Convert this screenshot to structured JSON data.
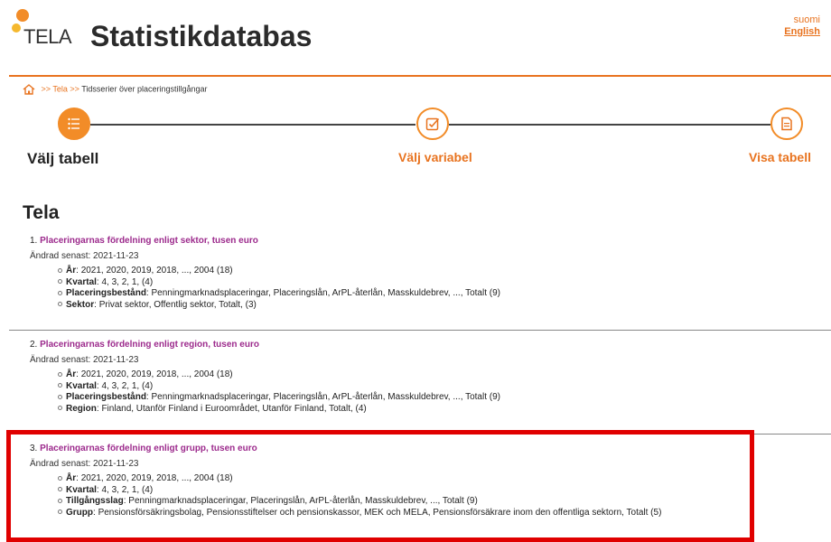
{
  "header": {
    "logo_text": "TELA",
    "title": "Statistikdatabas",
    "languages": [
      {
        "label": "suomi",
        "active": false
      },
      {
        "label": "English",
        "active": true
      }
    ]
  },
  "breadcrumb": {
    "home_icon": "home-icon",
    "separator": ">>",
    "items": [
      "Tela",
      "Tidsserier över placeringstillgångar"
    ]
  },
  "steps": [
    {
      "label": "Välj tabell",
      "icon": "list-icon",
      "active": true
    },
    {
      "label": "Välj variabel",
      "icon": "checkbox-icon",
      "active": false
    },
    {
      "label": "Visa tabell",
      "icon": "document-icon",
      "active": false
    }
  ],
  "section_title": "Tela",
  "updated_label": "Ändrad senast:",
  "tables": [
    {
      "number": "1.",
      "title": "Placeringarnas fördelning enligt sektor, tusen euro",
      "updated": "2021-11-23",
      "variables": [
        {
          "name": "År",
          "values": "2021, 2020, 2019, 2018, ..., 2004 (18)"
        },
        {
          "name": "Kvartal",
          "values": "4, 3, 2, 1, (4)"
        },
        {
          "name": "Placeringsbestånd",
          "values": "Penningmarknadsplaceringar, Placeringslån, ArPL-återlån, Masskuldebrev, ..., Totalt (9)"
        },
        {
          "name": "Sektor",
          "values": "Privat sektor, Offentlig sektor, Totalt, (3)"
        }
      ]
    },
    {
      "number": "2.",
      "title": "Placeringarnas fördelning enligt region, tusen euro",
      "updated": "2021-11-23",
      "variables": [
        {
          "name": "År",
          "values": "2021, 2020, 2019, 2018, ..., 2004 (18)"
        },
        {
          "name": "Kvartal",
          "values": "4, 3, 2, 1, (4)"
        },
        {
          "name": "Placeringsbestånd",
          "values": "Penningmarknadsplaceringar, Placeringslån, ArPL-återlån, Masskuldebrev, ..., Totalt (9)"
        },
        {
          "name": "Region",
          "values": "Finland, Utanför Finland i Euroområdet, Utanför Finland, Totalt, (4)"
        }
      ]
    },
    {
      "number": "3.",
      "title": "Placeringarnas fördelning enligt grupp, tusen euro",
      "updated": "2021-11-23",
      "variables": [
        {
          "name": "År",
          "values": "2021, 2020, 2019, 2018, ..., 2004 (18)"
        },
        {
          "name": "Kvartal",
          "values": "4, 3, 2, 1, (4)"
        },
        {
          "name": "Tillgångsslag",
          "values": "Penningmarknadsplaceringar, Placeringslån, ArPL-återlån, Masskuldebrev, ..., Totalt (9)"
        },
        {
          "name": "Grupp",
          "values": "Pensionsförsäkringsbolag, Pensionsstiftelser och pensionskassor, MEK och MELA, Pensionsförsäkrare inom den offentliga sektorn, Totalt (5)"
        }
      ]
    }
  ],
  "colors": {
    "accent": "#e8731f",
    "link": "#9c2a8c",
    "highlight": "#e00000"
  }
}
